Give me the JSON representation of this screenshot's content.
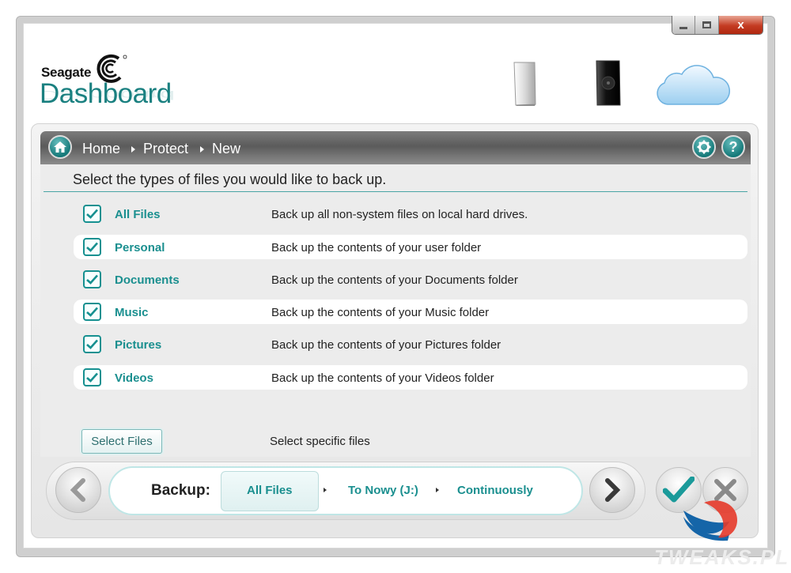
{
  "logo": {
    "brand": "Seagate",
    "product": "Dashboard"
  },
  "window_controls": {
    "close_glyph": "x",
    "minimize_icon": "minimize-icon",
    "maximize_icon": "maximize-icon"
  },
  "devices": [
    "external-drive-silver-icon",
    "external-drive-black-icon",
    "cloud-icon"
  ],
  "breadcrumb": {
    "home": "Home",
    "protect": "Protect",
    "new": "New"
  },
  "header_icons": {
    "settings": "gear-icon",
    "help": "?"
  },
  "instructions": "Select the types of files you would like to back up.",
  "file_types": [
    {
      "label": "All Files",
      "description": "Back up all non-system files on local hard drives.",
      "checked": true
    },
    {
      "label": "Personal",
      "description": "Back up the contents of your user folder",
      "checked": true
    },
    {
      "label": "Documents",
      "description": "Back up the contents of your Documents folder",
      "checked": true
    },
    {
      "label": "Music",
      "description": "Back up the contents of your Music folder",
      "checked": true
    },
    {
      "label": "Pictures",
      "description": "Back up the contents of your Pictures folder",
      "checked": true
    },
    {
      "label": "Videos",
      "description": "Back up the contents of your Videos folder",
      "checked": true
    }
  ],
  "select_files": {
    "button_label": "Select Files",
    "description": "Select specific files"
  },
  "summary": {
    "label": "Backup:",
    "what": "All Files",
    "destination": "To Nowy (J:)",
    "schedule": "Continuously"
  },
  "watermark": "TWEAKS.PL",
  "colors": {
    "accent": "#1a8f8f",
    "nav_bar": "#6a6a6a",
    "confirm": "#1b9a9a",
    "cancel": "#c0392b"
  }
}
